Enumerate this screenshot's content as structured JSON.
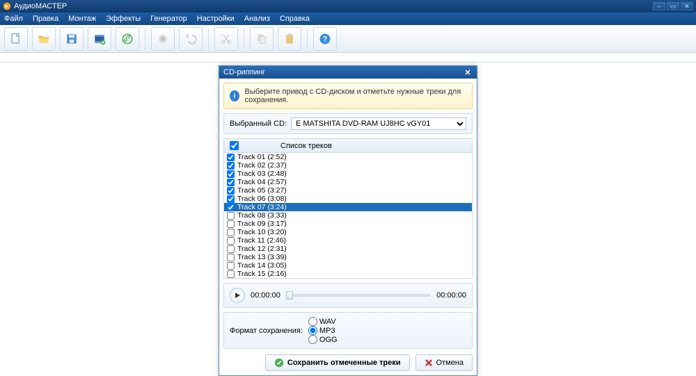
{
  "app": {
    "title": "АудиоМАСТЕР"
  },
  "menu": [
    "Файл",
    "Правка",
    "Монтаж",
    "Эффекты",
    "Генератор",
    "Настройки",
    "Анализ",
    "Справка"
  ],
  "toolbar": {
    "icons": [
      "new",
      "open",
      "save",
      "video",
      "music",
      "record",
      "undo",
      "cut",
      "copy",
      "paste",
      "help"
    ]
  },
  "dialog": {
    "title": "CD-риппинг",
    "info": "Выберите привод с CD-диском и отметьте нужные треки для сохранения.",
    "drive_label": "Выбранный CD:",
    "drive_value": "E MATSHITA DVD-RAM UJ8HC vGY01",
    "list_header": "Список треков",
    "tracks": [
      {
        "label": "Track 01",
        "dur": "(2:52)",
        "checked": true,
        "selected": false
      },
      {
        "label": "Track 02",
        "dur": "(2:37)",
        "checked": true,
        "selected": false
      },
      {
        "label": "Track 03",
        "dur": "(2:48)",
        "checked": true,
        "selected": false
      },
      {
        "label": "Track 04",
        "dur": "(2:57)",
        "checked": true,
        "selected": false
      },
      {
        "label": "Track 05",
        "dur": "(3:27)",
        "checked": true,
        "selected": false
      },
      {
        "label": "Track 06",
        "dur": "(3:08)",
        "checked": true,
        "selected": false
      },
      {
        "label": "Track 07",
        "dur": "(3:24)",
        "checked": true,
        "selected": true
      },
      {
        "label": "Track 08",
        "dur": "(3:33)",
        "checked": false,
        "selected": false
      },
      {
        "label": "Track 09",
        "dur": "(3:17)",
        "checked": false,
        "selected": false
      },
      {
        "label": "Track 10",
        "dur": "(3:20)",
        "checked": false,
        "selected": false
      },
      {
        "label": "Track 11",
        "dur": "(2:46)",
        "checked": false,
        "selected": false
      },
      {
        "label": "Track 12",
        "dur": "(2:31)",
        "checked": false,
        "selected": false
      },
      {
        "label": "Track 13",
        "dur": "(3:39)",
        "checked": false,
        "selected": false
      },
      {
        "label": "Track 14",
        "dur": "(3:05)",
        "checked": false,
        "selected": false
      },
      {
        "label": "Track 15",
        "dur": "(2:16)",
        "checked": false,
        "selected": false
      }
    ],
    "player": {
      "pos": "00:00:00",
      "dur": "00:00:00"
    },
    "format_label": "Формат сохранения:",
    "formats": [
      {
        "name": "WAV",
        "checked": false
      },
      {
        "name": "MP3",
        "checked": true
      },
      {
        "name": "OGG",
        "checked": false
      }
    ],
    "save_btn": "Сохранить отмеченные треки",
    "cancel_btn": "Отмена"
  }
}
